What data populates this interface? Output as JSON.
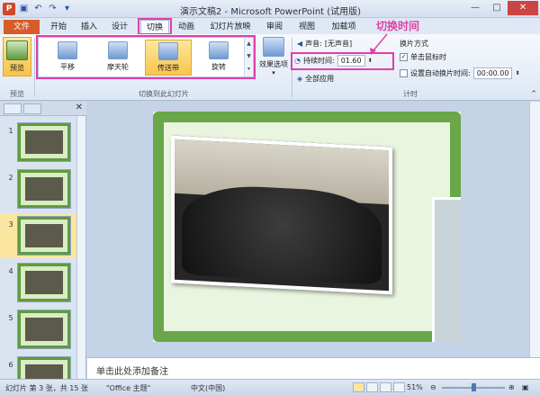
{
  "window": {
    "title": "演示文稿2 - Microsoft PowerPoint (试用版)",
    "app_icon_letter": "P"
  },
  "tabs": {
    "file": "文件",
    "items": [
      "开始",
      "插入",
      "设计",
      "切换",
      "动画",
      "幻灯片放映",
      "审阅",
      "视图",
      "加载项"
    ],
    "active": "切换"
  },
  "ribbon": {
    "preview": {
      "label": "预览",
      "group": "预览"
    },
    "transitions": [
      "平移",
      "摩天轮",
      "传送带",
      "旋转"
    ],
    "selected_transition": "传送带",
    "effect_options": "效果选项",
    "group_transitions": "切换到此幻灯片",
    "sound_label": "声音:",
    "sound_value": "[无声音]",
    "duration_label": "持续时间:",
    "duration_value": "01.60",
    "apply_all": "全部应用",
    "advance_title": "换片方式",
    "on_click": "单击鼠标时",
    "on_click_checked": true,
    "after_time": "设置自动换片时间:",
    "after_time_value": "00:00.00",
    "group_timing": "计时"
  },
  "annotation": {
    "label": "切换时间",
    "color": "#e23fa8"
  },
  "slides_panel": {
    "slides": [
      {
        "num": "1",
        "suffix": ""
      },
      {
        "num": "2",
        "suffix": ""
      },
      {
        "num": "3",
        "suffix": ""
      },
      {
        "num": "4",
        "suffix": ""
      },
      {
        "num": "5",
        "suffix": ""
      },
      {
        "num": "6",
        "suffix": ""
      }
    ],
    "selected_index": 2
  },
  "notes": {
    "placeholder": "单击此处添加备注"
  },
  "status": {
    "slide_info": "幻灯片 第 3 张，共 15 张",
    "theme": "\"Office 主题\"",
    "language": "中文(中国)",
    "zoom": "51%"
  }
}
